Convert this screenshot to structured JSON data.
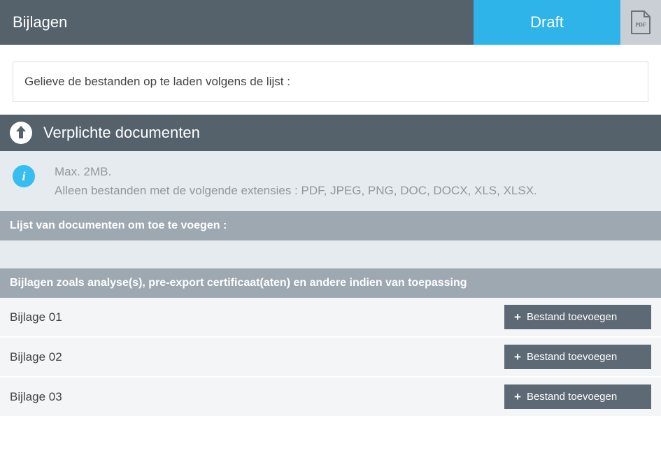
{
  "header": {
    "title": "Bijlagen",
    "status": "Draft",
    "pdf_icon_label": "PDF"
  },
  "instruction": "Gelieve de bestanden op te laden volgens de lijst :",
  "section": {
    "title": "Verplichte documenten"
  },
  "info": {
    "line1": "Max. 2MB.",
    "line2": "Alleen bestanden met de volgende extensies : PDF, JPEG, PNG, DOC, DOCX, XLS, XLSX."
  },
  "list_header": "Lijst van documenten om toe te voegen :",
  "group_header": "Bijlagen zoals analyse(s), pre-export certificaat(aten) en andere indien van toepassing",
  "attach_button_label": "Bestand toevoegen",
  "attachments": [
    {
      "label": "Bijlage 01"
    },
    {
      "label": "Bijlage 02"
    },
    {
      "label": "Bijlage 03"
    }
  ]
}
